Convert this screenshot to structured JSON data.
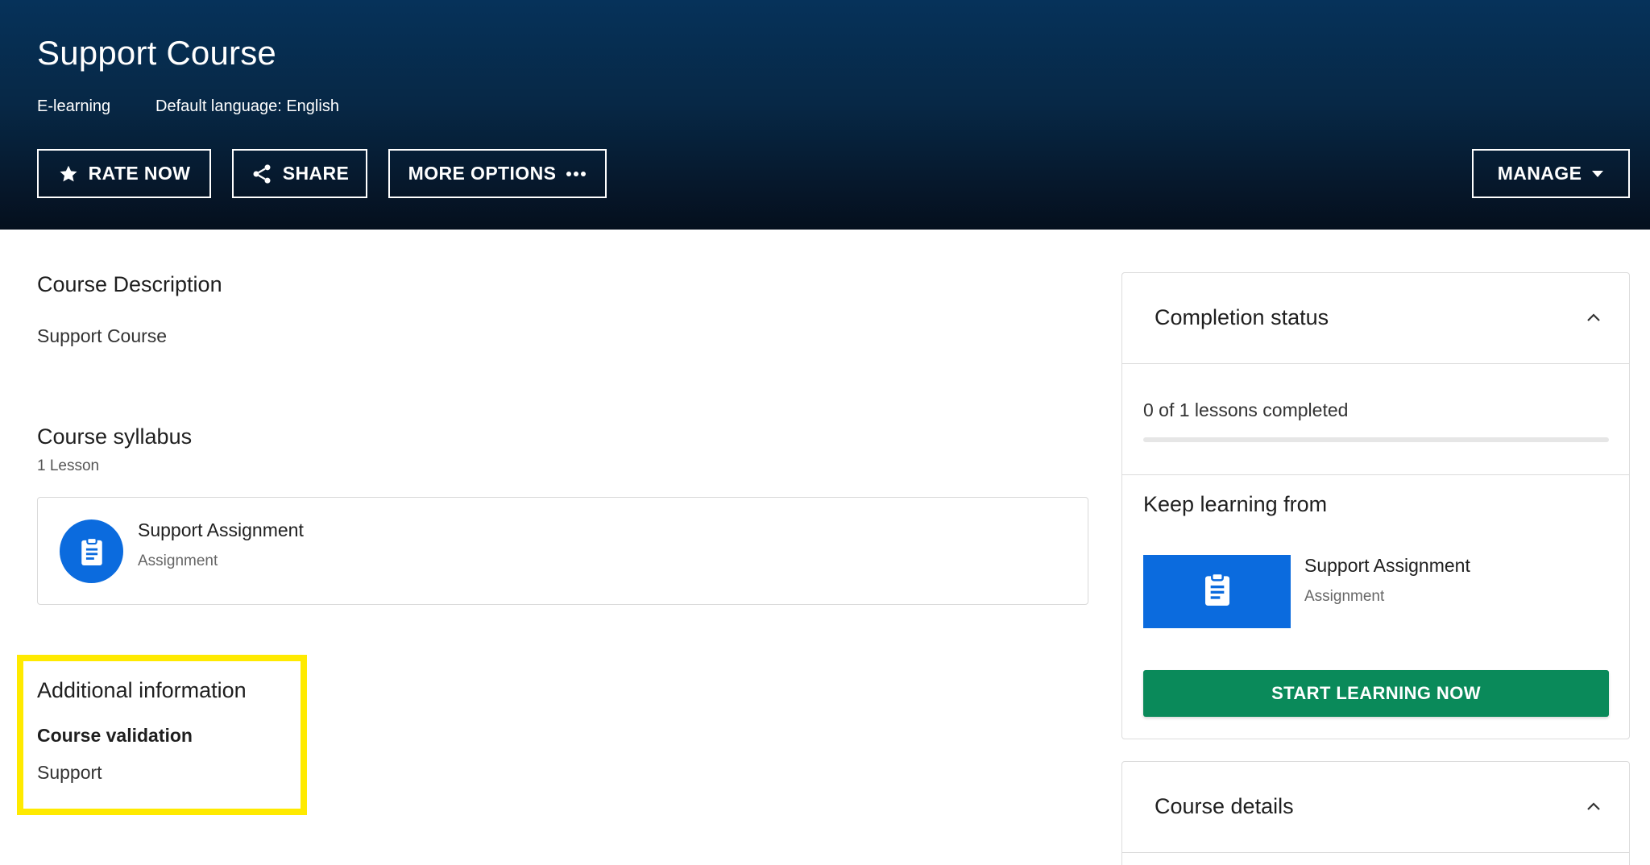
{
  "header": {
    "title": "Support Course",
    "type_label": "E-learning",
    "language_label": "Default language: English",
    "buttons": {
      "rate": "RATE NOW",
      "share": "SHARE",
      "more": "MORE OPTIONS",
      "manage": "MANAGE"
    }
  },
  "description": {
    "heading": "Course Description",
    "text": "Support Course"
  },
  "syllabus": {
    "heading": "Course syllabus",
    "count": "1 Lesson",
    "items": [
      {
        "title": "Support Assignment",
        "type": "Assignment",
        "icon": "assignment-icon"
      }
    ]
  },
  "additional": {
    "heading": "Additional information",
    "label": "Course validation",
    "value": "Support",
    "highlight_color": "#ffea00"
  },
  "completion": {
    "heading": "Completion status",
    "progress_text": "0 of 1 lessons completed",
    "progress_fraction": 0
  },
  "keep_learning": {
    "heading": "Keep learning from",
    "item_title": "Support Assignment",
    "item_type": "Assignment",
    "button": "START LEARNING NOW"
  },
  "course_details": {
    "heading": "Course details"
  },
  "colors": {
    "accent_blue": "#0b6bde",
    "start_green": "#0a8a5a",
    "header_dark": "#072846"
  }
}
